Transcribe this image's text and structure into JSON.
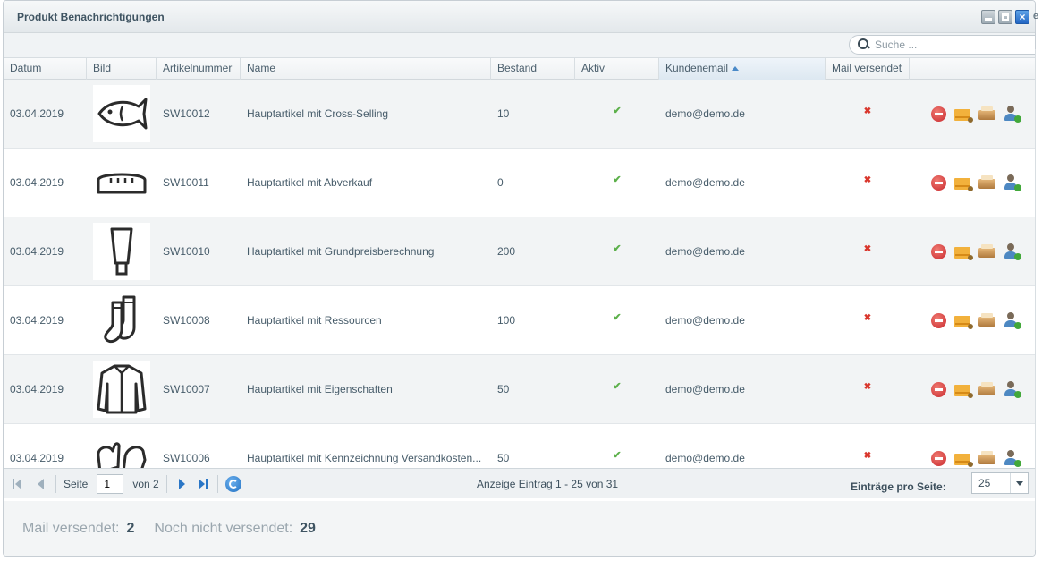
{
  "window": {
    "title": "Produkt Benachrichtigungen",
    "edge_text": "e"
  },
  "search": {
    "placeholder": "Suche ..."
  },
  "columns": {
    "datum": "Datum",
    "bild": "Bild",
    "artikelnummer": "Artikelnummer",
    "name": "Name",
    "bestand": "Bestand",
    "aktiv": "Aktiv",
    "kundenemail": "Kundenemail",
    "mail_versendet": "Mail versendet"
  },
  "rows": [
    {
      "datum": "03.04.2019",
      "image": "fish-icon",
      "artikelnummer": "SW10012",
      "name": "Hauptartikel mit Cross-Selling",
      "bestand": "10",
      "aktiv": "✔",
      "email": "demo@demo.de",
      "mail_versendet": "✖"
    },
    {
      "datum": "03.04.2019",
      "image": "bread-icon",
      "artikelnummer": "SW10011",
      "name": "Hauptartikel mit Abverkauf",
      "bestand": "0",
      "aktiv": "✔",
      "email": "demo@demo.de",
      "mail_versendet": "✖"
    },
    {
      "datum": "03.04.2019",
      "image": "tube-icon",
      "artikelnummer": "SW10010",
      "name": "Hauptartikel mit Grundpreisberechnung",
      "bestand": "200",
      "aktiv": "✔",
      "email": "demo@demo.de",
      "mail_versendet": "✖"
    },
    {
      "datum": "03.04.2019",
      "image": "socks-icon",
      "artikelnummer": "SW10008",
      "name": "Hauptartikel mit Ressourcen",
      "bestand": "100",
      "aktiv": "✔",
      "email": "demo@demo.de",
      "mail_versendet": "✖"
    },
    {
      "datum": "03.04.2019",
      "image": "jacket-icon",
      "artikelnummer": "SW10007",
      "name": "Hauptartikel mit Eigenschaften",
      "bestand": "50",
      "aktiv": "✔",
      "email": "demo@demo.de",
      "mail_versendet": "✖"
    },
    {
      "datum": "03.04.2019",
      "image": "mittens-icon",
      "artikelnummer": "SW10006",
      "name": "Hauptartikel mit Kennzeichnung Versandkosten...",
      "bestand": "50",
      "aktiv": "✔",
      "email": "demo@demo.de",
      "mail_versendet": "✖"
    }
  ],
  "pager": {
    "page_label": "Seite",
    "page_value": "1",
    "of_label": "von 2",
    "info": "Anzeige Eintrag 1 - 25 von 31",
    "per_page_label": "Einträge pro Seite:",
    "per_page_value": "25"
  },
  "footer": {
    "sent_label": "Mail versendet:",
    "sent_value": "2",
    "unsent_label": "Noch nicht versendet:",
    "unsent_value": "29"
  },
  "colors": {
    "check": "#5cb04a",
    "cross": "#d9362c",
    "accent": "#2a76c6"
  }
}
